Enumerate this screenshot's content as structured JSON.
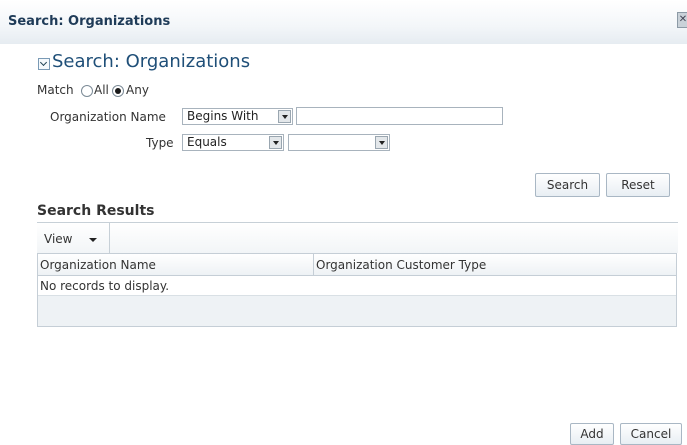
{
  "dialog": {
    "title": "Search: Organizations",
    "close_glyph": "✕"
  },
  "search": {
    "section_title": "Search: Organizations",
    "match_label": "Match",
    "match_all": "All",
    "match_any": "Any",
    "org_name_label": "Organization Name",
    "org_name_operator": "Begins With",
    "org_name_value": "",
    "type_label": "Type",
    "type_operator": "Equals",
    "type_value": "",
    "search_button": "Search",
    "reset_button": "Reset"
  },
  "results": {
    "title": "Search Results",
    "view_label": "View",
    "columns": [
      "Organization Name",
      "Organization Customer Type"
    ],
    "empty_text": "No records to display."
  },
  "footer": {
    "add_button": "Add",
    "cancel_button": "Cancel"
  },
  "icons": {
    "disclose": "disclose-expanded-icon",
    "dropdown": "chevron-down-icon"
  }
}
